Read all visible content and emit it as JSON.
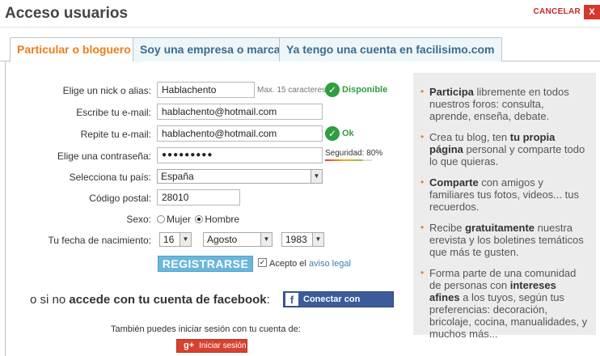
{
  "header": {
    "title": "Acceso usuarios",
    "cancel_label": "CANCELAR",
    "close_label": "X"
  },
  "tabs": [
    {
      "label": "Particular o bloguero"
    },
    {
      "label": "Soy una empresa o marca"
    },
    {
      "label": "Ya tengo una cuenta en facilisimo.com"
    }
  ],
  "form": {
    "nick": {
      "label": "Elige un nick o alias:",
      "value": "Hablachento",
      "hint": "Max. 15 caracteres",
      "status": "Disponible"
    },
    "email": {
      "label": "Escribe tu e-mail:",
      "value": "hablachento@hotmail.com"
    },
    "email_repeat": {
      "label": "Repite tu e-mail:",
      "value": "hablachento@hotmail.com",
      "status": "Ok"
    },
    "password": {
      "label": "Elige una contraseña:",
      "value": "●●●●●●●●●",
      "strength_label": "Seguridad: 80%",
      "strength": 0.8
    },
    "country": {
      "label": "Selecciona tu país:",
      "value": "España"
    },
    "postal": {
      "label": "Código postal:",
      "value": "28010"
    },
    "sex": {
      "label": "Sexo:",
      "option_female": "Mujer",
      "option_male": "Hombre",
      "selected": "Hombre"
    },
    "birth": {
      "label": "Tu fecha de nacimiento:",
      "day": "16",
      "month": "Agosto",
      "year": "1983"
    },
    "register_label": "REGISTRARSE",
    "legal_prefix": "Acepto el",
    "legal_link": "aviso legal"
  },
  "facebook": {
    "text_prefix": "o si no",
    "text_bold": "accede con tu cuenta de facebook",
    "text_suffix": ":",
    "button_icon": "f",
    "button_label": "Conectar con Facebook"
  },
  "gplus": {
    "text": "También puedes iniciar sesión con tu cuenta de:",
    "icon": "g+",
    "button_label": "Iniciar sesión"
  },
  "benefits": [
    {
      "bold": "Participa",
      "rest": " libremente en todos nuestros foros: consulta, aprende, enseña, debate."
    },
    {
      "pre": "Crea tu blog, ten ",
      "bold": "tu propia página",
      "rest": " personal y comparte todo lo que quieras."
    },
    {
      "bold": "Comparte",
      "rest": " con amigos y familiares tus fotos, videos... tus recuerdos."
    },
    {
      "pre": "Recibe ",
      "bold": "gratuitamente",
      "rest": " nuestra erevista y los boletines temáticos que más te gusten."
    },
    {
      "pre": "Forma parte de una comunidad de personas con ",
      "bold": "intereses afines",
      "rest": " a los tuyos, según tus preferencias: decoración, bricolaje, cocina, manualidades, y muchos más..."
    }
  ],
  "colors": {
    "accent": "#ef7d19",
    "ok": "#2f9e41",
    "facebook": "#3b5b99",
    "gplus": "#d8412f",
    "tab_text": "#3b6b8e"
  }
}
